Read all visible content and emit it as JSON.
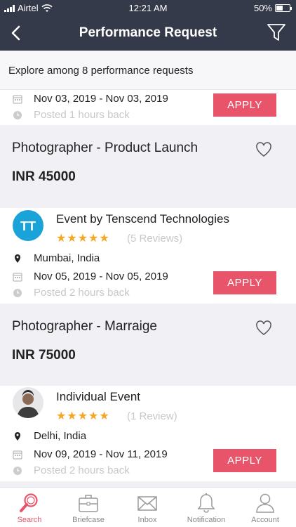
{
  "status": {
    "carrier": "Airtel",
    "time": "12:21 AM",
    "battery_text": "50%",
    "battery_level": 0.5
  },
  "nav": {
    "title": "Performance Request"
  },
  "explore_text": "Explore among 8 performance requests",
  "first_card": {
    "dates": "Nov 03, 2019 - Nov 03, 2019",
    "posted": "Posted 1 hours back",
    "apply": "APPLY"
  },
  "cards": [
    {
      "title": "Photographer - Product Launch",
      "price": "INR 45000",
      "event_name": "Event by Tenscend Technologies",
      "stars": "★★★★★",
      "reviews": "(5 Reviews)",
      "location": "Mumbai, India",
      "dates": "Nov 05, 2019 - Nov 05, 2019",
      "posted": "Posted 2 hours back",
      "apply": "APPLY",
      "avatar_logo": "TT"
    },
    {
      "title": "Photographer - Marraige",
      "price": "INR 75000",
      "event_name": "Individual Event",
      "stars": "★★★★★",
      "reviews": "(1 Review)",
      "location": "Delhi, India",
      "dates": "Nov 09, 2019 - Nov 11, 2019",
      "posted": "Posted 2 hours back",
      "apply": "APPLY"
    }
  ],
  "tabs": [
    {
      "label": "Search",
      "icon": "search-icon"
    },
    {
      "label": "Briefcase",
      "icon": "briefcase-icon"
    },
    {
      "label": "Inbox",
      "icon": "envelope-icon"
    },
    {
      "label": "Notification",
      "icon": "bell-icon"
    },
    {
      "label": "Account",
      "icon": "user-icon"
    }
  ],
  "colors": {
    "accent": "#e8556a",
    "header": "#353a4a",
    "star": "#f5a623",
    "logo": "#1aa3d9"
  }
}
